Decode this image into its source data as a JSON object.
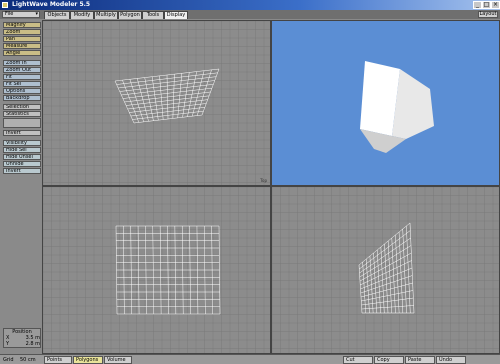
{
  "window": {
    "title": "LightWave Modeler 5.5"
  },
  "toolbar": {
    "file_label": "File",
    "tabs": [
      "Objects",
      "Modify",
      "Multiply",
      "Polygon",
      "Tools",
      "Display"
    ],
    "active_tab": "Display",
    "layout_label": "Layout"
  },
  "sidebar": {
    "buttons": [
      "Magnify",
      "Zoom",
      "Pan",
      "Measure",
      "Angle",
      "Zoom In",
      "Zoom Out",
      "Fit",
      "Fit Sel",
      "Options",
      "Backdrop",
      "Selection",
      "Statistics",
      "Invert",
      "Visibility",
      "Hide Sel",
      "Hide Unsel",
      "Unhide",
      "Invert"
    ]
  },
  "position": {
    "header": "Position",
    "x_label": "X",
    "x_value": "3.5 m",
    "y_label": "Y",
    "y_value": "2.8 m"
  },
  "statusbar": {
    "grid_label": "Grid",
    "grid_value": "50 cm",
    "buttons": [
      "Points",
      "Polygons",
      "Volume"
    ],
    "active": "Polygons",
    "cut": "Cut",
    "copy": "Copy",
    "paste": "Paste",
    "undo": "Undo"
  },
  "viewports": {
    "top_left_label": "Top",
    "camera_bg": "#5b8ed4"
  },
  "colors": {
    "accent": "#e9e39a",
    "viewport_bg": "#8c8c8c",
    "grid": "#7a7a7a",
    "mesh": "#ffffff"
  }
}
